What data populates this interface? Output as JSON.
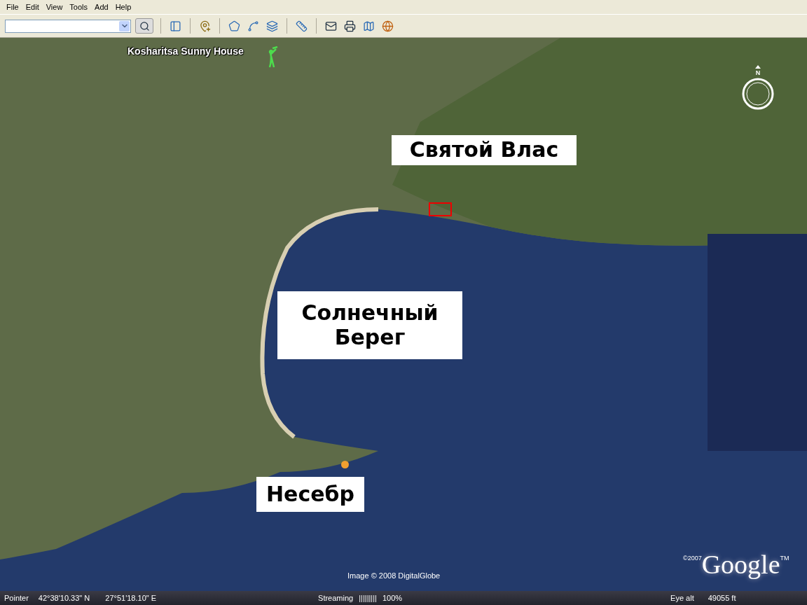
{
  "menu": [
    "File",
    "Edit",
    "View",
    "Tools",
    "Add",
    "Help"
  ],
  "map": {
    "placemark": "Kosharitsa Sunny House",
    "compass": "N",
    "labels": [
      {
        "text": "Святой Влас"
      },
      {
        "text": "Солнечный Берег"
      },
      {
        "text": "Несебр"
      }
    ],
    "credit": "Image © 2008 DigitalGlobe",
    "logo": {
      "copyright": "©2007",
      "name": "Google",
      "trademark": "TM"
    }
  },
  "status_bar": {
    "pointer_label": "Pointer",
    "latitude": "42°38'10.33\" N",
    "longitude": "27°51'18.10\" E",
    "streaming_label": "Streaming",
    "streaming_bars": "|||||||||",
    "streaming_percent": "100%",
    "eye_alt_label": "Eye alt",
    "eye_alt": "49055 ft"
  }
}
